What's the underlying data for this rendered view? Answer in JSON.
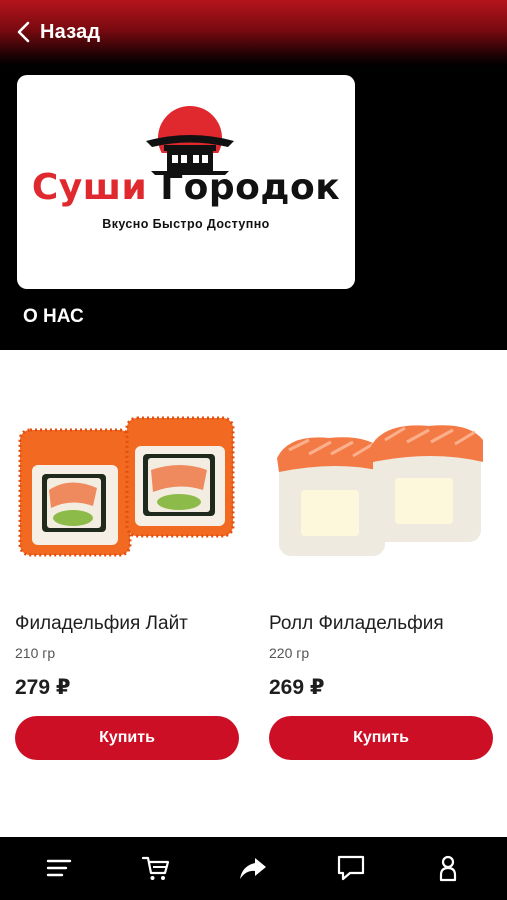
{
  "header": {
    "back_label": "Назад"
  },
  "hero": {
    "logo": {
      "brand_part1": "Суши",
      "brand_part2": "Городок",
      "tagline": "Вкусно Быстро Доступно"
    },
    "about_label": "О НАС"
  },
  "products": [
    {
      "name": "Филадельфия Лайт",
      "weight": "210 гр",
      "price": "279 ₽",
      "buy_label": "Купить"
    },
    {
      "name": "Ролл Филадельфия",
      "weight": "220 гр",
      "price": "269 ₽",
      "buy_label": "Купить"
    }
  ],
  "tabbar": {
    "items": [
      {
        "icon": "menu-icon"
      },
      {
        "icon": "cart-icon"
      },
      {
        "icon": "share-icon"
      },
      {
        "icon": "chat-icon"
      },
      {
        "icon": "profile-icon"
      }
    ]
  },
  "colors": {
    "accent": "#cd0f26",
    "header_gradient_top": "#b4141c",
    "background_dark": "#000000",
    "logo_red": "#e0282f"
  }
}
